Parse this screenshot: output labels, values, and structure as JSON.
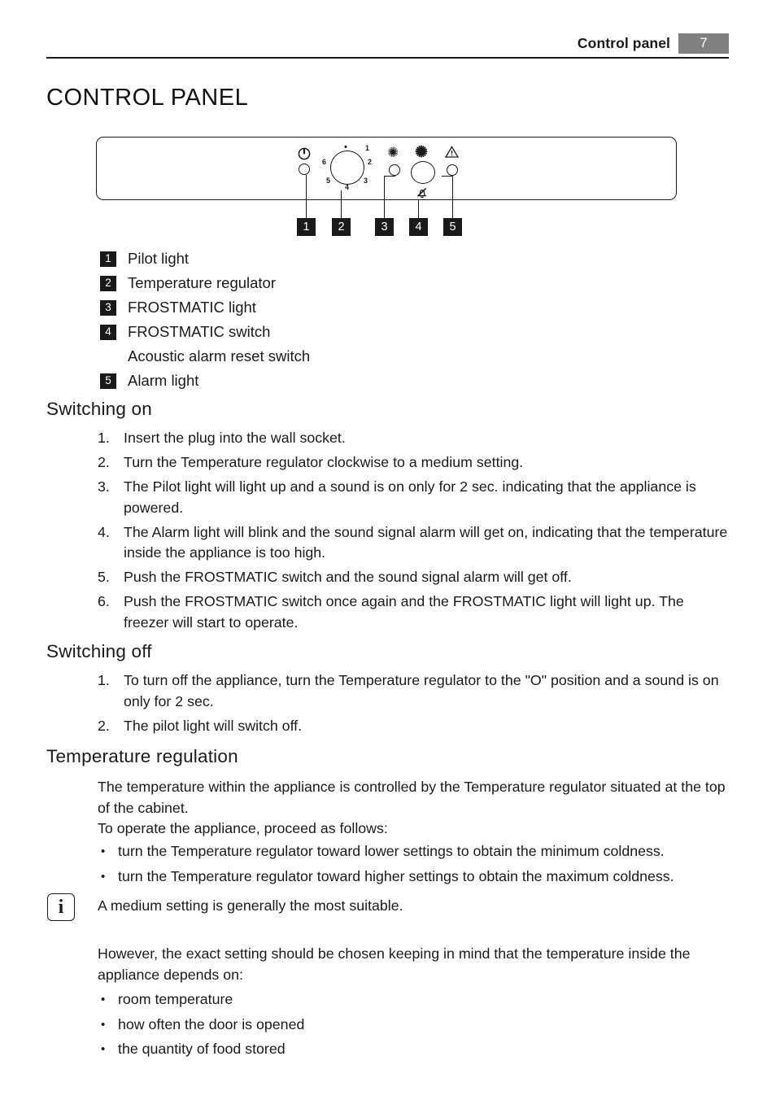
{
  "header": {
    "title": "Control panel",
    "page_number": "7",
    "badge_color": "#808080"
  },
  "chapter_title": "CONTROL PANEL",
  "figure": {
    "name": "control-panel-diagram",
    "callout_badges": [
      "1",
      "2",
      "3",
      "4",
      "5"
    ],
    "dial": {
      "marker": "•",
      "numbers": [
        "1",
        "2",
        "3",
        "4",
        "5",
        "6"
      ]
    },
    "icons": {
      "pilot": "power-icon",
      "frostmatic_light": "snowflake-icon",
      "frostmatic_switch": "snowflake-bold-icon",
      "alarm_mute": "bell-crossed-icon",
      "alarm": "warning-triangle-icon"
    }
  },
  "legend": [
    {
      "num": "1",
      "label": "Pilot light"
    },
    {
      "num": "2",
      "label": "Temperature regulator"
    },
    {
      "num": "3",
      "label": "FROSTMATIC light"
    },
    {
      "num": "4",
      "label": "FROSTMATIC switch"
    },
    {
      "num": "",
      "label": "Acoustic alarm reset switch"
    },
    {
      "num": "5",
      "label": "Alarm light"
    }
  ],
  "switching_on": {
    "heading": "Switching on",
    "items": [
      {
        "num": "1.",
        "text": "Insert the plug into the wall socket."
      },
      {
        "num": "2.",
        "text": "Turn the Temperature regulator clockwise to a medium setting."
      },
      {
        "num": "3.",
        "text": "The Pilot light will light up and a sound is on only for 2 sec. indicating that the appliance is powered."
      },
      {
        "num": "4.",
        "text": "The Alarm light will blink and the sound signal alarm will get on, indicating that the temperature inside the appliance is too high."
      },
      {
        "num": "5.",
        "text": "Push the FROSTMATIC switch and the sound signal alarm will get off."
      },
      {
        "num": "6.",
        "text": "Push the FROSTMATIC switch once again and the FROSTMATIC light will light up. The freezer will start to operate."
      }
    ]
  },
  "switching_off": {
    "heading": "Switching off",
    "items": [
      {
        "num": "1.",
        "text": "To turn off the appliance, turn the Temperature regulator to the \"O\" position and a sound is on only for 2 sec."
      },
      {
        "num": "2.",
        "text": "The pilot light will switch off."
      }
    ]
  },
  "temperature_regulation": {
    "heading": "Temperature regulation",
    "intro": "The temperature within the appliance is controlled by the Temperature regulator situated at the top of the cabinet.",
    "intro2": "To operate the appliance, proceed as follows:",
    "bullets": [
      "turn the Temperature regulator toward lower settings to obtain the minimum coldness.",
      "turn the Temperature regulator toward higher settings to obtain the maximum coldness."
    ],
    "note_icon_glyph": "i",
    "note_text": "A medium setting is generally the most suitable.",
    "however": "However, the exact setting should be chosen keeping in mind that the temperature inside the appliance depends on:",
    "factors": [
      "room temperature",
      "how often the door is opened",
      "the quantity of food stored"
    ]
  }
}
